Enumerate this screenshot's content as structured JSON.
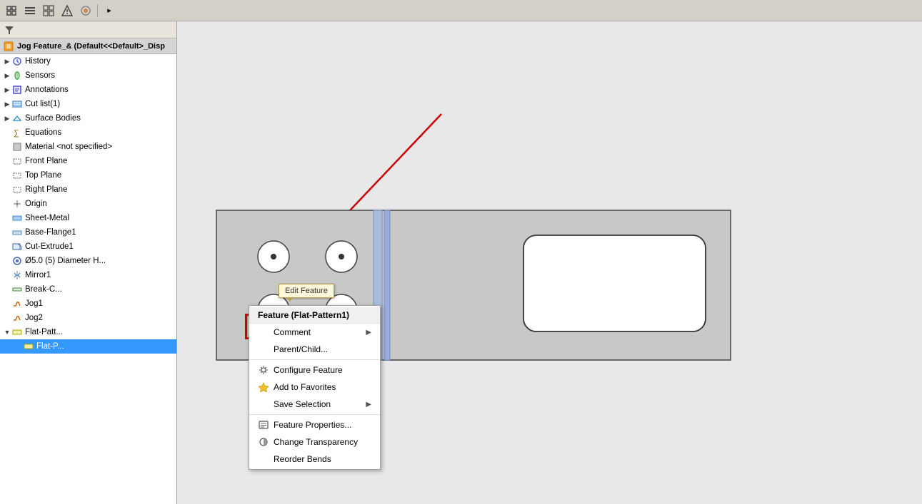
{
  "toolbar": {
    "buttons": [
      "⬜",
      "☰",
      "⊞",
      "✦",
      "◉",
      "▸"
    ]
  },
  "tree": {
    "header": {
      "title": "Jog Feature_& (Default<<Default>_Disp"
    },
    "items": [
      {
        "id": "history",
        "label": "History",
        "indent": 1,
        "expandable": true,
        "icon": "history"
      },
      {
        "id": "sensors",
        "label": "Sensors",
        "indent": 1,
        "expandable": true,
        "icon": "sensor"
      },
      {
        "id": "annotations",
        "label": "Annotations",
        "indent": 1,
        "expandable": true,
        "icon": "annotation"
      },
      {
        "id": "cut-list",
        "label": "Cut list(1)",
        "indent": 1,
        "expandable": true,
        "icon": "cut"
      },
      {
        "id": "surface-bodies",
        "label": "Surface Bodies",
        "indent": 1,
        "expandable": true,
        "icon": "surface"
      },
      {
        "id": "equations",
        "label": "Equations",
        "indent": 1,
        "expandable": false,
        "icon": "equation"
      },
      {
        "id": "material",
        "label": "Material <not specified>",
        "indent": 1,
        "expandable": false,
        "icon": "material"
      },
      {
        "id": "front-plane",
        "label": "Front Plane",
        "indent": 1,
        "expandable": false,
        "icon": "plane"
      },
      {
        "id": "top-plane",
        "label": "Top Plane",
        "indent": 1,
        "expandable": false,
        "icon": "plane"
      },
      {
        "id": "right-plane",
        "label": "Right Plane",
        "indent": 1,
        "expandable": false,
        "icon": "plane"
      },
      {
        "id": "origin",
        "label": "Origin",
        "indent": 1,
        "expandable": false,
        "icon": "origin"
      },
      {
        "id": "sheet-metal",
        "label": "Sheet-Metal",
        "indent": 1,
        "expandable": false,
        "icon": "feature"
      },
      {
        "id": "base-flange",
        "label": "Base-Flange1",
        "indent": 1,
        "expandable": false,
        "icon": "feature"
      },
      {
        "id": "cut-extrude",
        "label": "Cut-Extrude1",
        "indent": 1,
        "expandable": false,
        "icon": "feature"
      },
      {
        "id": "diameter-hole",
        "label": "Ø5.0 (5) Diameter H...",
        "indent": 1,
        "expandable": false,
        "icon": "feature"
      },
      {
        "id": "mirror1",
        "label": "Mirror1",
        "indent": 1,
        "expandable": false,
        "icon": "feature"
      },
      {
        "id": "break-c",
        "label": "Break-C...",
        "indent": 1,
        "expandable": false,
        "icon": "feature"
      },
      {
        "id": "jog1",
        "label": "Jog1",
        "indent": 1,
        "expandable": false,
        "icon": "feature"
      },
      {
        "id": "jog2",
        "label": "Jog2",
        "indent": 1,
        "expandable": false,
        "icon": "feature"
      },
      {
        "id": "flat-pattern",
        "label": "Flat-Patt...",
        "indent": 1,
        "expandable": true,
        "icon": "feature"
      },
      {
        "id": "flat-sub",
        "label": "Flat-P...",
        "indent": 2,
        "expandable": false,
        "icon": "feature",
        "selected": true
      }
    ]
  },
  "context_menu": {
    "title": "Feature (Flat-Pattern1)",
    "items": [
      {
        "id": "comment",
        "label": "Comment",
        "has_arrow": true,
        "has_icon": false
      },
      {
        "id": "parent-child",
        "label": "Parent/Child...",
        "has_arrow": false,
        "has_icon": false
      },
      {
        "id": "separator1",
        "type": "separator"
      },
      {
        "id": "configure-feature",
        "label": "Configure Feature",
        "has_arrow": false,
        "has_icon": true,
        "icon": "⚙"
      },
      {
        "id": "add-to-favorites",
        "label": "Add to Favorites",
        "has_arrow": false,
        "has_icon": true,
        "icon": "★"
      },
      {
        "id": "save-selection",
        "label": "Save Selection",
        "has_arrow": true,
        "has_icon": false
      },
      {
        "id": "separator2",
        "type": "separator"
      },
      {
        "id": "feature-properties",
        "label": "Feature Properties...",
        "has_arrow": false,
        "has_icon": true,
        "icon": "📋"
      },
      {
        "id": "change-transparency",
        "label": "Change Transparency",
        "has_arrow": false,
        "has_icon": true,
        "icon": "◑"
      },
      {
        "id": "reorder-bends",
        "label": "Reorder Bends",
        "has_arrow": false,
        "has_icon": false
      }
    ]
  },
  "edit_feature_tooltip": "Edit Feature",
  "mini_toolbar": {
    "buttons": [
      "⚙",
      "🔧",
      "🎨"
    ]
  },
  "viewport": {
    "background_color": "#e8e8e8"
  }
}
